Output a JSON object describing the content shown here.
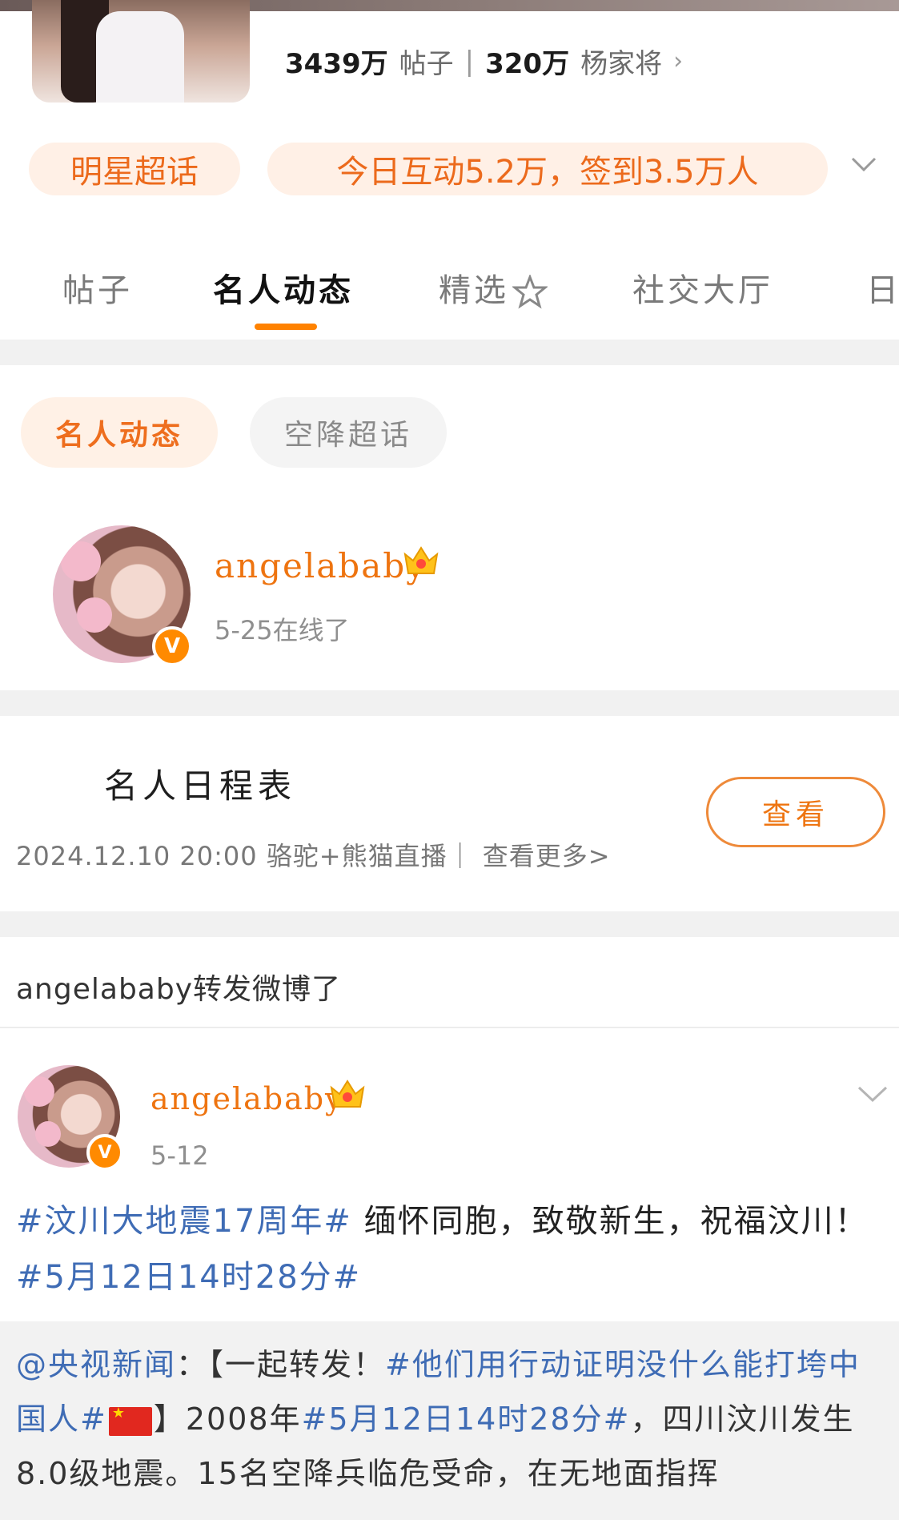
{
  "header": {
    "posts_count": "3439万",
    "posts_label": "帖子",
    "fans_count": "320万",
    "fans_label": "杨家将",
    "chip_left": "明星超话",
    "chip_right": "今日互动5.2万，签到3.5万人"
  },
  "tabs": [
    "帖子",
    "名人动态",
    "精选",
    "社交大厅",
    "日"
  ],
  "active_tab": "名人动态",
  "sub_chips": [
    "名人动态",
    "空降超话"
  ],
  "user": {
    "name": "angelababy",
    "status": "5-25在线了"
  },
  "schedule": {
    "title": "名人日程表",
    "detail": "2024.12.10 20:00 骆驼+熊猫直播｜ 查看更多>",
    "button": "查看"
  },
  "repost_note": "angelababy转发微博了",
  "post": {
    "author": "angelababy",
    "date": "5-12",
    "tag1": "#汶川大地震17周年#",
    "text1": " 缅怀同胞，致敬新生，祝福汶川！",
    "tag2": "#5月12日14时28分#"
  },
  "quote": {
    "mention": "@央视新闻",
    "p1": "：【一起转发！",
    "tag1": "#他们用行动证明没什么能打垮中国人#",
    "p2": "】2008年",
    "tag2": "#5月12日14时28分#",
    "p3": "，四川汶川发生8.0级地震。15名空降兵临危受命，在无地面指挥"
  },
  "colors": {
    "accent": "#ff8200",
    "brand_orange": "#ee7410",
    "link_blue": "#3f6cb5"
  },
  "icons": [
    "chevron-right-icon",
    "chevron-down-icon",
    "star-icon",
    "crown-icon",
    "verified-badge-icon",
    "china-flag-icon"
  ]
}
